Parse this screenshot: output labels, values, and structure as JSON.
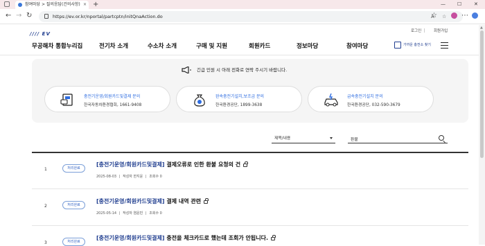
{
  "browser": {
    "tab_title": "참여마당 > 질의응답(건의사항)",
    "tab_close": "×",
    "new_tab": "+",
    "url": "https://ev.or.kr/nportal/partcptn/initQnaAction.do",
    "win_minimize": "—",
    "win_maximize": "☐",
    "win_close": "✕"
  },
  "site": {
    "logo_mark": "//// EV",
    "logo_text": "무공해차 통합누리집",
    "util_login": "로그인",
    "util_join": "회원가입",
    "nav": [
      "전기차 소개",
      "수소차 소개",
      "구매 및 지원",
      "회원카드",
      "정보마당",
      "참여마당"
    ],
    "find_station": "가까운 충전소 찾기"
  },
  "notice": {
    "title": "긴급 민원 시 아래 전화로 연락 주시기 바랍니다.",
    "contacts": [
      {
        "title": "충전기운영/회원카드및결제 문의",
        "sub": "한국자동차환경협회, 1661-9408"
      },
      {
        "title": "완속충전기설치,보조금 문의",
        "sub": "한국환경공단, 1899-3638"
      },
      {
        "title": "급속충전기설치 문의",
        "sub": "한국환경공단, 032-590-3679"
      }
    ]
  },
  "search": {
    "select_value": "제목/내용",
    "query": "환불"
  },
  "posts": [
    {
      "num": "1",
      "status": "처리완료",
      "category": "[충전기운영/회원카드및결제]",
      "title": " 결제오류로 인한 환불 요청의 건",
      "date": "2025-08-03",
      "author": "작성자 한지윤",
      "views": "조회수 0"
    },
    {
      "num": "2",
      "status": "처리완료",
      "category": "[충전기운영/회원카드및결제]",
      "title": " 결제 내역 관련",
      "date": "2025-05-14",
      "author": "작성자 염윤빈",
      "views": "조회수 0"
    },
    {
      "num": "3",
      "status": "처리완료",
      "category": "[충전기운영/회원카드및결제]",
      "title": " 충전을 체크카드로 했는데 조회가 안됩니다.",
      "date": "",
      "author": "",
      "views": ""
    }
  ],
  "colors": {
    "accent": "#2d6ce0",
    "brand": "#1f3d8f"
  }
}
